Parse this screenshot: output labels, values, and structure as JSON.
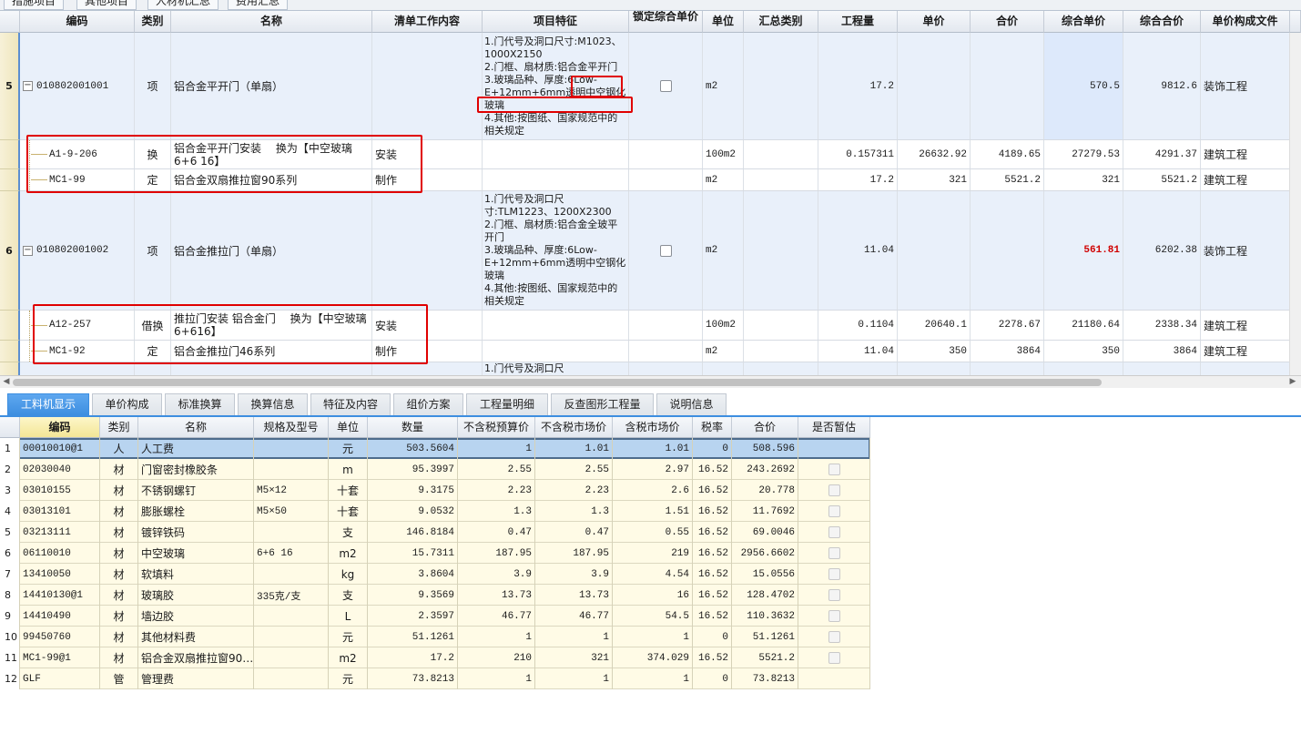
{
  "top_tabs": [
    "措施项目",
    "其他项目",
    "人材机汇总",
    "费用汇总"
  ],
  "upper_headers": [
    "编码",
    "类别",
    "名称",
    "清单工作内容",
    "项目特征",
    "锁定综合单价",
    "单位",
    "汇总类别",
    "工程量",
    "单价",
    "合价",
    "综合单价",
    "综合合价",
    "单价构成文件"
  ],
  "upper_rows": [
    {
      "row_no": "5",
      "code": "010802001001",
      "type": "项",
      "name": "铝合金平开门（单扇）",
      "work": "",
      "feature": "1.门代号及洞口尺寸:M1023、1000X2150\n2.门框、扇材质:铝合金平开门\n3.玻璃品种、厚度:6Low-E+12mm+6mm透明中空钢化玻璃\n4.其他:按图纸、国家规范中的相关规定",
      "unit": "m2",
      "summary": "",
      "qty": "17.2",
      "price": "",
      "total": "",
      "comp_price": "570.5",
      "comp_total": "9812.6",
      "file": "装饰工程"
    },
    {
      "row_no": "",
      "code": "A1-9-206",
      "type": "换",
      "name": "铝合金平开门安装　 换为【中空玻璃6+6 16】",
      "work": "安装",
      "feature": "",
      "unit": "100m2",
      "summary": "",
      "qty": "0.157311",
      "price": "26632.92",
      "total": "4189.65",
      "comp_price": "27279.53",
      "comp_total": "4291.37",
      "file": "建筑工程"
    },
    {
      "row_no": "",
      "code": "MC1-99",
      "type": "定",
      "name": "铝合金双扇推拉窗90系列",
      "work": "制作",
      "feature": "",
      "unit": "m2",
      "summary": "",
      "qty": "17.2",
      "price": "321",
      "total": "5521.2",
      "comp_price": "321",
      "comp_total": "5521.2",
      "file": "建筑工程"
    },
    {
      "row_no": "6",
      "code": "010802001002",
      "type": "项",
      "name": "铝合金推拉门（单扇）",
      "work": "",
      "feature": "1.门代号及洞口尺寸:TLM1223、1200X2300\n2.门框、扇材质:铝合金全玻平开门\n3.玻璃品种、厚度:6Low-E+12mm+6mm透明中空钢化玻璃\n4.其他:按图纸、国家规范中的相关规定",
      "unit": "m2",
      "summary": "",
      "qty": "11.04",
      "price": "",
      "total": "",
      "comp_price": "561.81",
      "comp_total": "6202.38",
      "file": "装饰工程"
    },
    {
      "row_no": "",
      "code": "A12-257",
      "type": "借换",
      "name": "推拉门安装 铝合金门　 换为【中空玻璃6+616】",
      "work": "安装",
      "feature": "",
      "unit": "100m2",
      "summary": "",
      "qty": "0.1104",
      "price": "20640.1",
      "total": "2278.67",
      "comp_price": "21180.64",
      "comp_total": "2338.34",
      "file": "建筑工程"
    },
    {
      "row_no": "",
      "code": "MC1-92",
      "type": "定",
      "name": "铝合金推拉门46系列",
      "work": "制作",
      "feature": "",
      "unit": "m2",
      "summary": "",
      "qty": "11.04",
      "price": "350",
      "total": "3864",
      "comp_price": "350",
      "comp_total": "3864",
      "file": "建筑工程"
    },
    {
      "row_no": "",
      "code": "",
      "type": "",
      "name": "",
      "work": "",
      "feature": "1.门代号及洞口尺",
      "unit": "",
      "summary": "",
      "qty": "",
      "price": "",
      "total": "",
      "comp_price": "",
      "comp_total": "",
      "file": ""
    }
  ],
  "bottom_tabs": [
    "工料机显示",
    "单价构成",
    "标准换算",
    "换算信息",
    "特征及内容",
    "组价方案",
    "工程量明细",
    "反查图形工程量",
    "说明信息"
  ],
  "lower_headers": [
    "编码",
    "类别",
    "名称",
    "规格及型号",
    "单位",
    "数量",
    "不含税预算价",
    "不含税市场价",
    "含税市场价",
    "税率",
    "合价",
    "是否暂估"
  ],
  "lower_rows": [
    [
      "1",
      "00010010@1",
      "人",
      "人工费",
      "",
      "元",
      "503.5604",
      "1",
      "1.01",
      "1.01",
      "0",
      "508.596"
    ],
    [
      "2",
      "02030040",
      "材",
      "门窗密封橡胶条",
      "",
      "m",
      "95.3997",
      "2.55",
      "2.55",
      "2.97",
      "16.52",
      "243.2692"
    ],
    [
      "3",
      "03010155",
      "材",
      "不锈钢螺钉",
      "M5×12",
      "十套",
      "9.3175",
      "2.23",
      "2.23",
      "2.6",
      "16.52",
      "20.778"
    ],
    [
      "4",
      "03013101",
      "材",
      "膨胀螺栓",
      "M5×50",
      "十套",
      "9.0532",
      "1.3",
      "1.3",
      "1.51",
      "16.52",
      "11.7692"
    ],
    [
      "5",
      "03213111",
      "材",
      "镀锌铁码",
      "",
      "支",
      "146.8184",
      "0.47",
      "0.47",
      "0.55",
      "16.52",
      "69.0046"
    ],
    [
      "6",
      "06110010",
      "材",
      "中空玻璃",
      "6+6 16",
      "m2",
      "15.7311",
      "187.95",
      "187.95",
      "219",
      "16.52",
      "2956.6602"
    ],
    [
      "7",
      "13410050",
      "材",
      "软填料",
      "",
      "kg",
      "3.8604",
      "3.9",
      "3.9",
      "4.54",
      "16.52",
      "15.0556"
    ],
    [
      "8",
      "14410130@1",
      "材",
      "玻璃胶",
      "335克/支",
      "支",
      "9.3569",
      "13.73",
      "13.73",
      "16",
      "16.52",
      "128.4702"
    ],
    [
      "9",
      "14410490",
      "材",
      "墙边胶",
      "",
      "L",
      "2.3597",
      "46.77",
      "46.77",
      "54.5",
      "16.52",
      "110.3632"
    ],
    [
      "10",
      "99450760",
      "材",
      "其他材料费",
      "",
      "元",
      "51.1261",
      "1",
      "1",
      "1",
      "0",
      "51.1261"
    ],
    [
      "11",
      "MC1-99@1",
      "材",
      "铝合金双扇推拉窗90…",
      "",
      "m2",
      "17.2",
      "210",
      "321",
      "374.029",
      "16.52",
      "5521.2"
    ],
    [
      "12",
      "GLF",
      "管",
      "管理费",
      "",
      "元",
      "73.8213",
      "1",
      "1",
      "1",
      "0",
      "73.8213"
    ]
  ]
}
